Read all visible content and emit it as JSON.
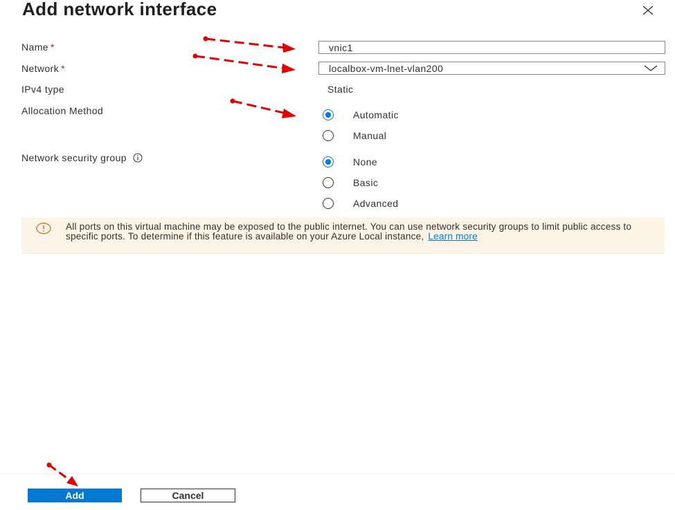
{
  "dialog": {
    "title": "Add network interface",
    "close_icon": "close-icon"
  },
  "form": {
    "name": {
      "label": "Name",
      "required_marker": "*",
      "value": "vnic1"
    },
    "network": {
      "label": "Network",
      "required_marker": "*",
      "selected": "localbox-vm-lnet-vlan200",
      "icon": "chevron-down-icon"
    },
    "ipv4_type": {
      "label": "IPv4 type",
      "value": "Static"
    },
    "allocation_method": {
      "label": "Allocation Method",
      "options": [
        {
          "label": "Automatic",
          "checked": true
        },
        {
          "label": "Manual",
          "checked": false
        }
      ]
    },
    "network_security_group": {
      "label": "Network security group",
      "info_icon": "info-icon",
      "options": [
        {
          "label": "None",
          "checked": true
        },
        {
          "label": "Basic",
          "checked": false
        },
        {
          "label": "Advanced",
          "checked": false
        }
      ]
    }
  },
  "warning": {
    "icon": "warning-icon",
    "message": "All ports on this virtual machine may be exposed to the public internet. You can use network security groups to limit public access to specific ports. To determine if this feature is available on your Azure Local instance,",
    "link_text": "Learn more"
  },
  "footer": {
    "add_label": "Add",
    "cancel_label": "Cancel"
  },
  "colors": {
    "accent": "#0078d4",
    "annotation_arrow": "#e00000",
    "warning_background": "#fdf3e7",
    "required": "#a4262c"
  }
}
